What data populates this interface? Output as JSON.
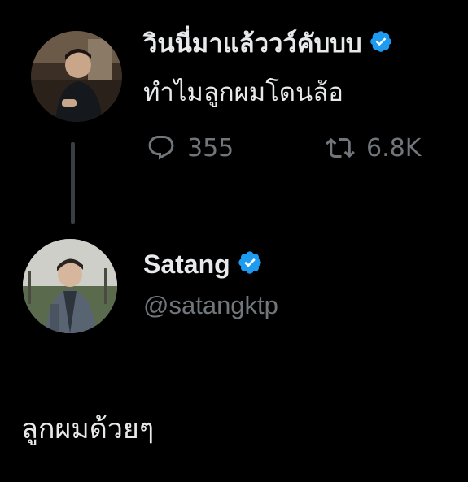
{
  "colors": {
    "background": "#000000",
    "text_primary": "#e7e9ea",
    "text_secondary": "#71767b",
    "verified_blue": "#1d9bf0",
    "thread_line": "#3a3d41"
  },
  "parent_tweet": {
    "author": {
      "display_name": "วินนี่มาแล้ววว์คับบบ",
      "verified": true,
      "avatar_icon": "profile-photo"
    },
    "text": "ทำไมลูกผมโดนล้อ",
    "stats": {
      "replies": "355",
      "replies_icon": "reply-icon",
      "retweets": "6.8K",
      "retweets_icon": "retweet-icon"
    }
  },
  "reply_tweet": {
    "author": {
      "display_name": "Satang",
      "handle": "@satangktp",
      "verified": true,
      "avatar_icon": "profile-photo"
    },
    "text": "ลูกผมด้วยๆ"
  }
}
